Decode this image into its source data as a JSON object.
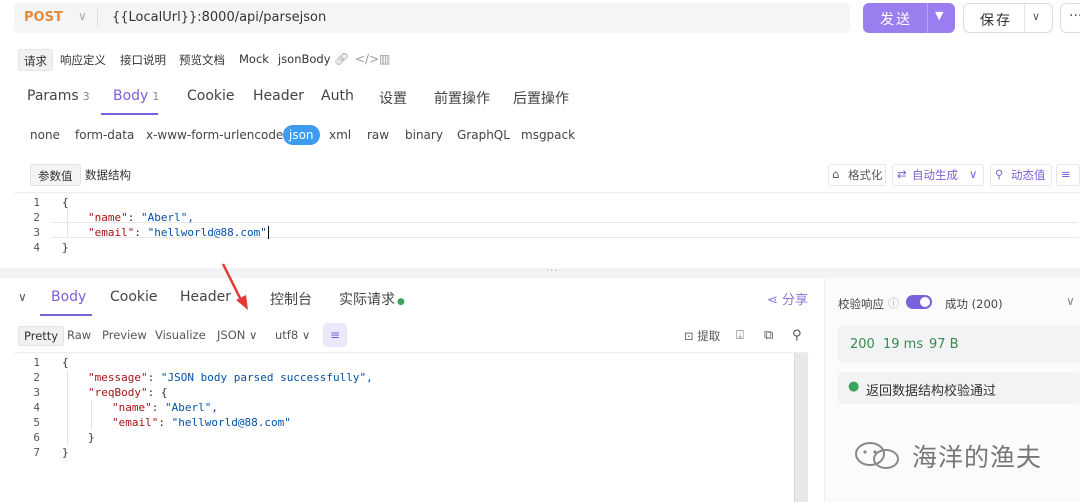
{
  "request": {
    "method": "POST",
    "url": "{{LocalUrl}}:8000/api/parsejson",
    "send_label": "发送",
    "save_label": "保存",
    "more_label": "···"
  },
  "doc_tabs": [
    "请求",
    "响应定义",
    "接口说明",
    "预览文档",
    "Mock",
    "jsonBody"
  ],
  "request_tabs": [
    {
      "label": "Params",
      "count": "3"
    },
    {
      "label": "Body",
      "count": "1"
    },
    {
      "label": "Cookie",
      "count": ""
    },
    {
      "label": "Header",
      "count": ""
    },
    {
      "label": "Auth",
      "count": ""
    },
    {
      "label": "设置",
      "count": ""
    },
    {
      "label": "前置操作",
      "count": ""
    },
    {
      "label": "后置操作",
      "count": ""
    }
  ],
  "body_types": [
    "none",
    "form-data",
    "x-www-form-urlencoded",
    "json",
    "xml",
    "raw",
    "binary",
    "GraphQL",
    "msgpack"
  ],
  "editor_segments": [
    "参数值",
    "数据结构"
  ],
  "editor_tools": {
    "format": "格式化",
    "autogen": "自动生成",
    "dynamic": "动态值"
  },
  "request_body_lines": [
    {
      "n": "1",
      "t": "{"
    },
    {
      "n": "2",
      "k": "\"name\"",
      "v": "\"Aberl\","
    },
    {
      "n": "3",
      "k": "\"email\"",
      "v": "\"hellworld@88.com\""
    },
    {
      "n": "4",
      "t": "}"
    }
  ],
  "response_tabs": [
    "Body",
    "Cookie",
    "Header",
    "控制台",
    "实际请求"
  ],
  "share_label": "分享",
  "response_view": {
    "pretty": "Pretty",
    "raw": "Raw",
    "preview": "Preview",
    "visualize": "Visualize",
    "format": "JSON",
    "encoding": "utf8",
    "extract": "提取"
  },
  "response_body_lines": [
    {
      "n": "1",
      "indent": 0,
      "t": "{"
    },
    {
      "n": "2",
      "indent": 1,
      "k": "\"message\"",
      "v": "\"JSON body parsed successfully\","
    },
    {
      "n": "3",
      "indent": 1,
      "k": "\"reqBody\"",
      "v": "{"
    },
    {
      "n": "4",
      "indent": 2,
      "k": "\"name\"",
      "v": "\"Aberl\","
    },
    {
      "n": "5",
      "indent": 2,
      "k": "\"email\"",
      "v": "\"hellworld@88.com\""
    },
    {
      "n": "6",
      "indent": 1,
      "t": "}"
    },
    {
      "n": "7",
      "indent": 0,
      "t": "}"
    }
  ],
  "validation": {
    "label": "校验响应",
    "status": "成功 (200)",
    "code": "200",
    "time": "19 ms",
    "size": "97 B",
    "message": "返回数据结构校验通过"
  },
  "watermark": "海洋的渔夫",
  "colors": {
    "accent": "#7b61d9",
    "method": "#e68a3a",
    "json_badge": "#3d9cf0",
    "success": "#3aa55d"
  }
}
